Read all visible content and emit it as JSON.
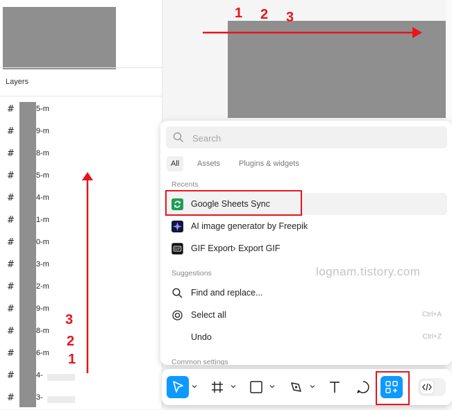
{
  "layers": {
    "title": "Layers",
    "items": [
      {
        "icon": "#",
        "label": "5-m"
      },
      {
        "icon": "#",
        "label": "9-m"
      },
      {
        "icon": "#",
        "label": "8-m"
      },
      {
        "icon": "#",
        "label": "5-m"
      },
      {
        "icon": "#",
        "label": "4-m"
      },
      {
        "icon": "#",
        "label": "1-m"
      },
      {
        "icon": "#",
        "label": "0-m"
      },
      {
        "icon": "#",
        "label": "3-m"
      },
      {
        "icon": "#",
        "label": "2-m"
      },
      {
        "icon": "#",
        "label": "9-m"
      },
      {
        "icon": "#",
        "label": "8-m"
      },
      {
        "icon": "#",
        "label": "6-m"
      },
      {
        "icon": "#",
        "label": "4-"
      },
      {
        "icon": "#",
        "label": "3-"
      }
    ]
  },
  "annotations": {
    "vertical": [
      "3",
      "2",
      "1"
    ],
    "horizontal": [
      "1",
      "2",
      "3"
    ]
  },
  "popup": {
    "search_placeholder": "Search",
    "tabs": [
      "All",
      "Assets",
      "Plugins & widgets"
    ],
    "recents_label": "Recents",
    "recents": [
      {
        "label": "Google Sheets Sync",
        "icon": "sync-icon"
      },
      {
        "label": "AI image generator by Freepik",
        "icon": "freepik-icon"
      },
      {
        "label": "GIF Export› Export GIF",
        "icon": "gif-icon"
      }
    ],
    "suggestions_label": "Suggestions",
    "suggestions": [
      {
        "label": "Find and replace...",
        "shortcut": "",
        "icon": "search-icon"
      },
      {
        "label": "Select all",
        "shortcut": "Ctrl+A",
        "icon": "target-icon"
      },
      {
        "label": "Undo",
        "shortcut": "Ctrl+Z",
        "icon": ""
      }
    ],
    "common_label": "Common settings"
  },
  "watermark": "lognam.tistory.com",
  "colors": {
    "accent": "#0d99ff",
    "annotation": "#e8131c"
  }
}
